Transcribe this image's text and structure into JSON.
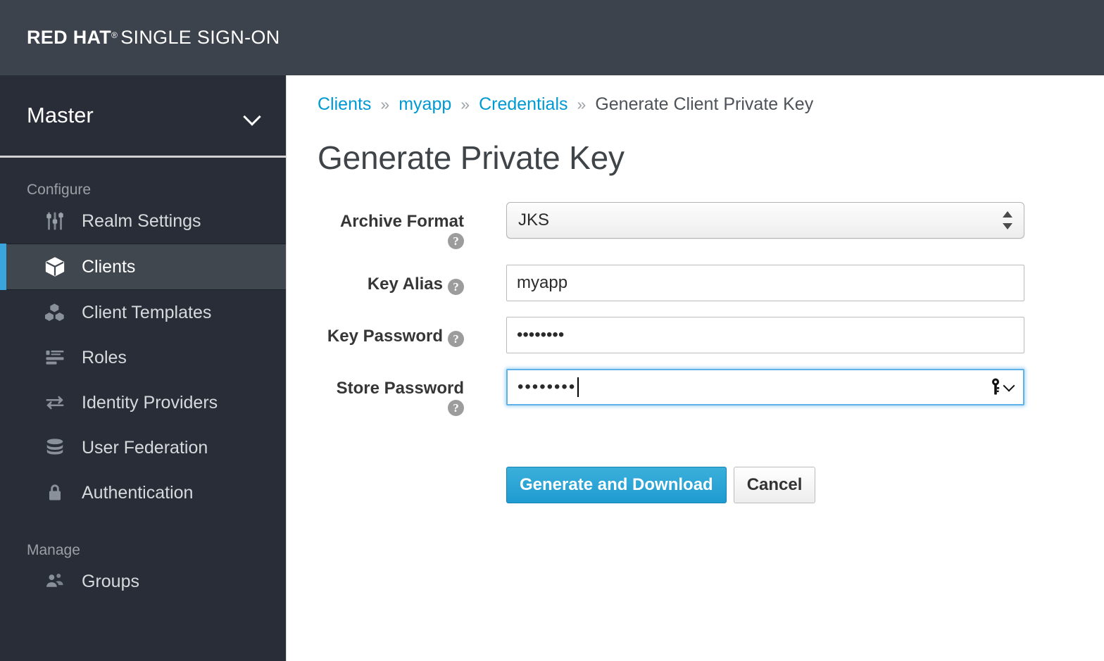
{
  "masthead": {
    "brand_bold": "RED HAT",
    "brand_reg": "®",
    "brand_light": "SINGLE SIGN-ON"
  },
  "sidebar": {
    "realm": {
      "name": "Master",
      "chevron_icon": "chevron-down-icon"
    },
    "sections": [
      {
        "title": "Configure",
        "items": [
          {
            "label": "Realm Settings",
            "icon": "sliders-icon",
            "active": false
          },
          {
            "label": "Clients",
            "icon": "cube-icon",
            "active": true
          },
          {
            "label": "Client Templates",
            "icon": "cubes-icon",
            "active": false
          },
          {
            "label": "Roles",
            "icon": "list-icon",
            "active": false
          },
          {
            "label": "Identity Providers",
            "icon": "exchange-arrows-icon",
            "active": false
          },
          {
            "label": "User Federation",
            "icon": "database-icon",
            "active": false
          },
          {
            "label": "Authentication",
            "icon": "lock-icon",
            "active": false
          }
        ]
      },
      {
        "title": "Manage",
        "items": [
          {
            "label": "Groups",
            "icon": "users-icon",
            "active": false
          }
        ]
      }
    ]
  },
  "main": {
    "breadcrumb": {
      "separator": "»",
      "items": [
        {
          "label": "Clients",
          "link": true
        },
        {
          "label": "myapp",
          "link": true
        },
        {
          "label": "Credentials",
          "link": true
        },
        {
          "label": "Generate Client Private Key",
          "link": false
        }
      ]
    },
    "page_title": "Generate Private Key",
    "form": {
      "help_glyph": "?",
      "fields": [
        {
          "label": "Archive Format",
          "type": "select",
          "value": "JKS",
          "help_icon": "help-circle-icon",
          "help_on_new_line": true
        },
        {
          "label": "Key Alias",
          "type": "text",
          "value": "myapp",
          "placeholder": "",
          "help_icon": "help-circle-icon",
          "help_on_new_line": false
        },
        {
          "label": "Key Password",
          "type": "password",
          "value": "••••••••",
          "placeholder": "",
          "help_icon": "help-circle-icon",
          "help_on_new_line": false
        },
        {
          "label": "Store Password",
          "type": "password",
          "value": "••••••••",
          "placeholder": "",
          "help_icon": "help-circle-icon",
          "help_on_new_line": true,
          "focused": true,
          "key_icon": "password-key-icon"
        }
      ],
      "buttons": {
        "primary": "Generate and Download",
        "secondary": "Cancel"
      }
    }
  },
  "colors": {
    "masthead_bg": "#3c434d",
    "sidebar_bg": "#282d37",
    "active_bg": "#40474f",
    "active_marker": "#39a5dc",
    "link": "#0099d3",
    "primary_button": "#1f9bd1",
    "focus_border": "#5eb2e8"
  }
}
